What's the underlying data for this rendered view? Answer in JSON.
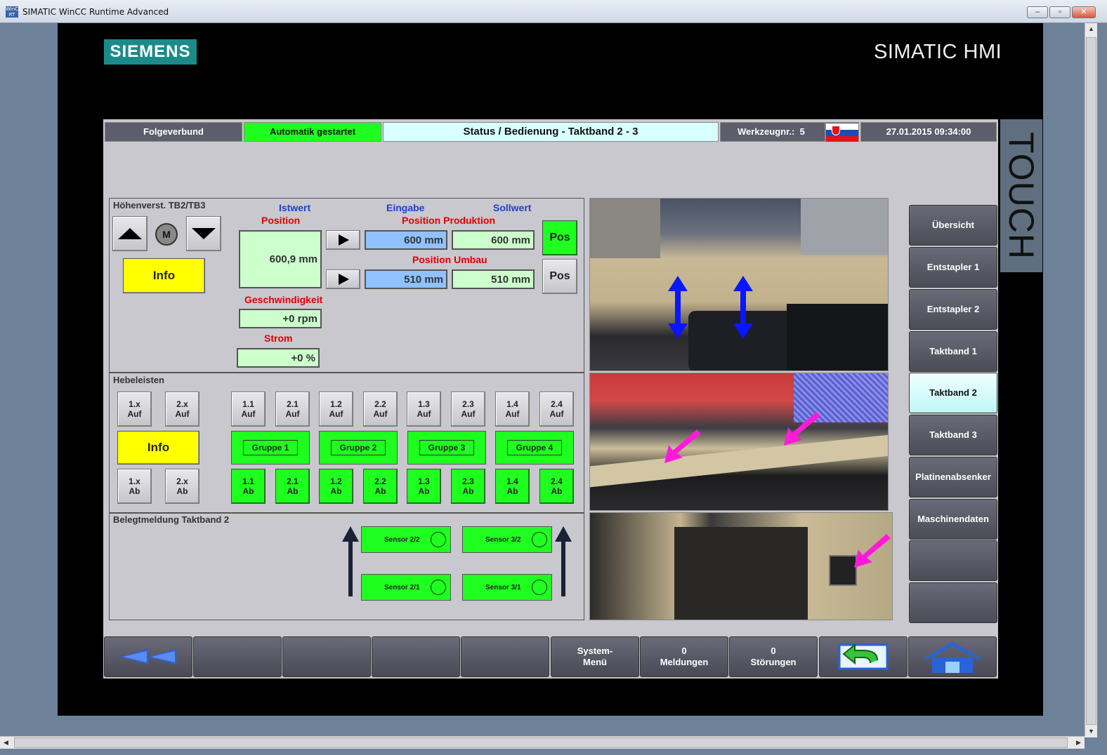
{
  "window": {
    "title": "SIMATIC WinCC Runtime Advanced",
    "app_icon": "WinCC RT"
  },
  "branding": {
    "logo": "SIEMENS",
    "product": "SIMATIC HMI",
    "touch": "TOUCH"
  },
  "header": {
    "operation_mode": "Folgeverbund",
    "status": "Automatik gestartet",
    "screen_title": "Status / Bedienung - Taktband 2 - 3",
    "tool_label": "Werkzeugnr.:",
    "tool_number": "5",
    "datetime": "27.01.2015 09:34:00"
  },
  "height_adjust": {
    "title": "Höhenverst. TB2/TB3",
    "motor_label": "M",
    "info": "Info",
    "istwert": "Istwert",
    "position": "Position",
    "position_value": "600,9 mm",
    "eingabe": "Eingabe",
    "sollwert": "Sollwert",
    "position_produktion": "Position Produktion",
    "produktion_input": "600 mm",
    "produktion_soll": "600 mm",
    "position_umbau": "Position Umbau",
    "umbau_input": "510 mm",
    "umbau_soll": "510 mm",
    "pos1": "Pos",
    "pos2": "Pos",
    "geschwindigkeit": "Geschwindigkeit",
    "speed_value": "+0 rpm",
    "strom": "Strom",
    "current_value": "+0 %"
  },
  "hebeleisten": {
    "title": "Hebeleisten",
    "info": "Info",
    "left_auf": [
      [
        "1.x",
        "Auf"
      ],
      [
        "2.x",
        "Auf"
      ]
    ],
    "left_ab": [
      [
        "1.x",
        "Ab"
      ],
      [
        "2.x",
        "Ab"
      ]
    ],
    "auf": [
      [
        "1.1",
        "Auf"
      ],
      [
        "2.1",
        "Auf"
      ],
      [
        "1.2",
        "Auf"
      ],
      [
        "2.2",
        "Auf"
      ],
      [
        "1.3",
        "Auf"
      ],
      [
        "2.3",
        "Auf"
      ],
      [
        "1.4",
        "Auf"
      ],
      [
        "2.4",
        "Auf"
      ]
    ],
    "groups": [
      "Gruppe 1",
      "Gruppe 2",
      "Gruppe 3",
      "Gruppe 4"
    ],
    "ab": [
      [
        "1.1",
        "Ab"
      ],
      [
        "2.1",
        "Ab"
      ],
      [
        "1.2",
        "Ab"
      ],
      [
        "2.2",
        "Ab"
      ],
      [
        "1.3",
        "Ab"
      ],
      [
        "2.3",
        "Ab"
      ],
      [
        "1.4",
        "Ab"
      ],
      [
        "2.4",
        "Ab"
      ]
    ]
  },
  "belegt": {
    "title": "Belegtmeldung Taktband 2",
    "sensors": [
      "Sensor 2/2",
      "Sensor 3/2",
      "Sensor 2/1",
      "Sensor 3/1"
    ]
  },
  "nav": [
    "Übersicht",
    "Entstapler 1",
    "Entstapler 2",
    "Taktband 1",
    "Taktband 2",
    "Taktband 3",
    "Platinenabsenker",
    "Maschinendaten",
    "",
    ""
  ],
  "nav_active": "Taktband 2",
  "bottom": {
    "system_menu": [
      "System-",
      "Menü"
    ],
    "meldungen": [
      "0",
      "Meldungen"
    ],
    "stoerungen": [
      "0",
      "Störungen"
    ]
  },
  "colors": {
    "status_green": "#1fff1f",
    "info_yellow": "#ffff00",
    "title_cyan": "#d8ffff",
    "alarm_red": "#e00000",
    "label_blue": "#1f3fd0"
  }
}
